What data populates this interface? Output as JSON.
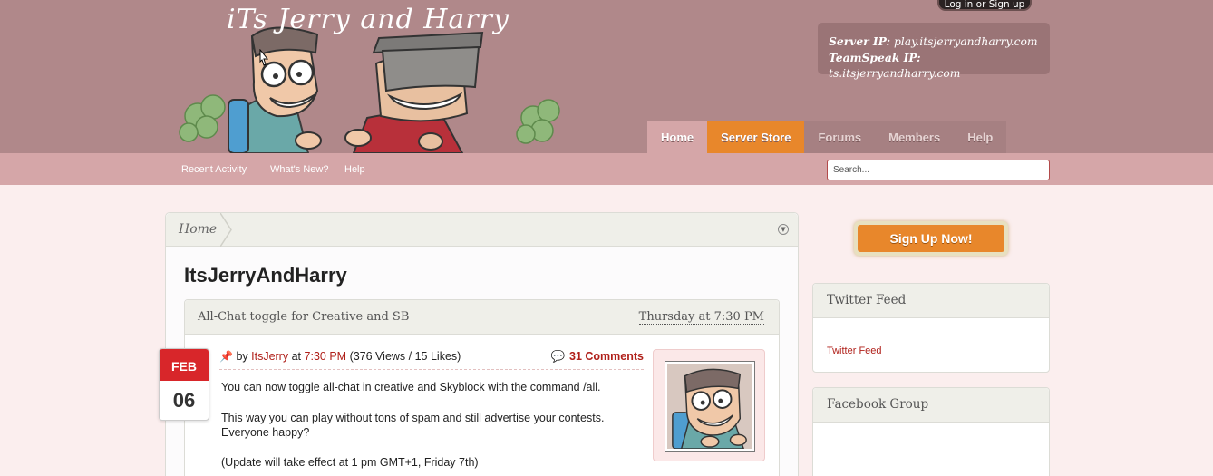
{
  "header": {
    "logo_title": "iTs Jerry and Harry",
    "login_label": "Log in or Sign up",
    "server_ip_label": "Server IP:",
    "server_ip": "play.itsjerryandharry.com",
    "teamspeak_label": "TeamSpeak IP:",
    "teamspeak_ip": "ts.itsjerryandharry.com"
  },
  "nav": {
    "tabs": [
      {
        "label": "Home"
      },
      {
        "label": "Server Store"
      },
      {
        "label": "Forums"
      },
      {
        "label": "Members"
      },
      {
        "label": "Help"
      }
    ],
    "sub_links": [
      {
        "label": "Recent Activity"
      },
      {
        "label": "What's New?"
      },
      {
        "label": "Help"
      }
    ],
    "search_placeholder": "Search..."
  },
  "breadcrumb": {
    "home": "Home"
  },
  "page_title": "ItsJerryAndHarry",
  "post": {
    "title": "All-Chat toggle for Creative and SB",
    "date": "Thursday at 7:30 PM",
    "by": "by",
    "author": "ItsJerry",
    "at": "at",
    "time": "7:30 PM",
    "stats": "(376 Views / 15 Likes)",
    "comments": "31 Comments",
    "badge_month": "FEB",
    "badge_day": "06",
    "body": [
      "You can now toggle all-chat in creative and Skyblock with the command /all.",
      "This way you can play without tons of spam and still advertise your contests.",
      "Everyone happy?",
      "(Update will take effect at 1 pm GMT+1, Friday 7th)"
    ]
  },
  "sidebar": {
    "signup_label": "Sign Up Now!",
    "twitter_title": "Twitter Feed",
    "twitter_link": "Twitter Feed",
    "facebook_title": "Facebook Group"
  },
  "colors": {
    "header_bg": "#b0888a",
    "subnav_bg": "#d5a6a8",
    "accent_orange": "#e8872b",
    "link_red": "#b0201a",
    "page_bg": "#fbeeee"
  }
}
